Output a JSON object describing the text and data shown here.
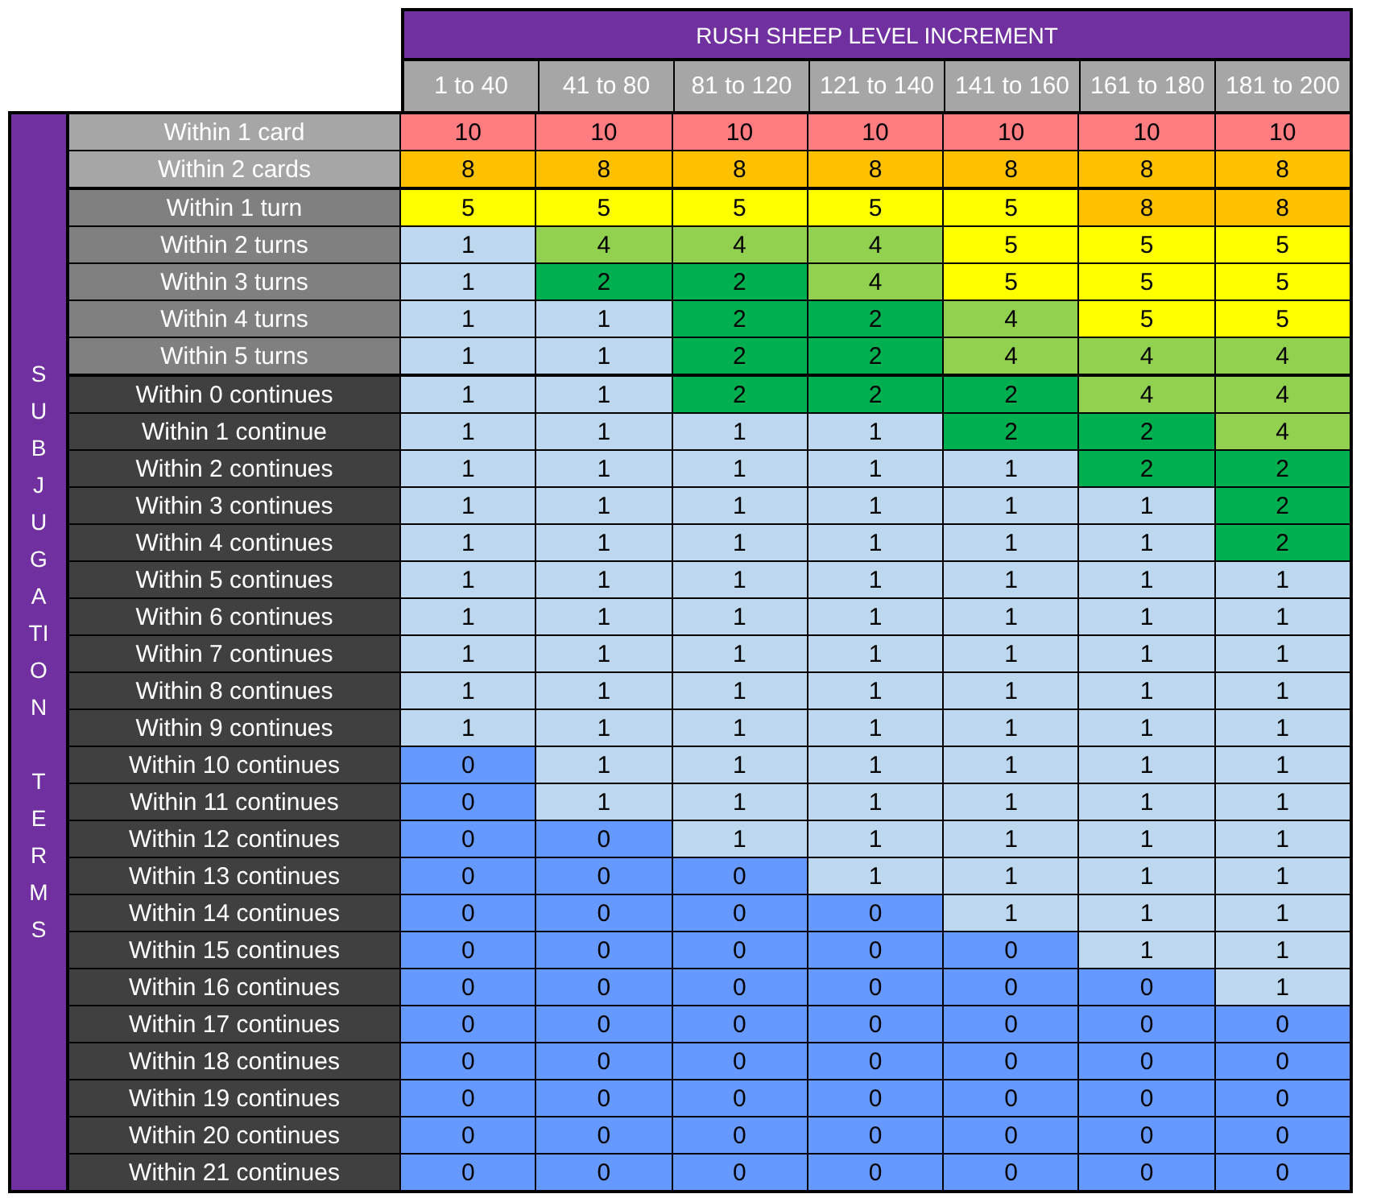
{
  "title": "RUSH SHEEP LEVEL INCREMENT",
  "columns": [
    "1 to 40",
    "41 to 80",
    "81 to 120",
    "121 to 140",
    "141 to 160",
    "161 to 180",
    "181 to 200"
  ],
  "side_label": "SUBJUGATION TERMS",
  "row_groups": [
    {
      "kind": "cards",
      "rows": [
        {
          "label": "Within 1 card",
          "cells": [
            {
              "text": "10",
              "color": "#ff7c80"
            },
            {
              "text": "10",
              "color": "#ff7c80"
            },
            {
              "text": "10",
              "color": "#ff7c80"
            },
            {
              "text": "10",
              "color": "#ff7c80"
            },
            {
              "text": "10",
              "color": "#ff7c80"
            },
            {
              "text": "10",
              "color": "#ff7c80"
            },
            {
              "text": "10",
              "color": "#ff7c80"
            }
          ]
        },
        {
          "label": "Within 2 cards",
          "cells": [
            {
              "text": "8",
              "color": "#ffc000"
            },
            {
              "text": "8",
              "color": "#ffc000"
            },
            {
              "text": "8",
              "color": "#ffc000"
            },
            {
              "text": "8",
              "color": "#ffc000"
            },
            {
              "text": "8",
              "color": "#ffc000"
            },
            {
              "text": "8",
              "color": "#ffc000"
            },
            {
              "text": "8",
              "color": "#ffc000"
            }
          ]
        }
      ]
    },
    {
      "kind": "turns",
      "rows": [
        {
          "label": "Within 1 turn",
          "cells": [
            {
              "text": "5",
              "color": "#ffff00"
            },
            {
              "text": "5",
              "color": "#ffff00"
            },
            {
              "text": "5",
              "color": "#ffff00"
            },
            {
              "text": "5",
              "color": "#ffff00"
            },
            {
              "text": "5",
              "color": "#ffff00"
            },
            {
              "text": "8",
              "color": "#ffc000"
            },
            {
              "text": "8",
              "color": "#ffc000"
            }
          ]
        },
        {
          "label": "Within 2 turns",
          "cells": [
            {
              "text": "1",
              "color": "#bdd7ee"
            },
            {
              "text": "4",
              "color": "#92d050"
            },
            {
              "text": "4",
              "color": "#92d050"
            },
            {
              "text": "4",
              "color": "#92d050"
            },
            {
              "text": "5",
              "color": "#ffff00"
            },
            {
              "text": "5",
              "color": "#ffff00"
            },
            {
              "text": "5",
              "color": "#ffff00"
            }
          ]
        },
        {
          "label": "Within 3 turns",
          "cells": [
            {
              "text": "1",
              "color": "#bdd7ee"
            },
            {
              "text": "2",
              "color": "#00b050"
            },
            {
              "text": "2",
              "color": "#00b050"
            },
            {
              "text": "4",
              "color": "#92d050"
            },
            {
              "text": "5",
              "color": "#ffff00"
            },
            {
              "text": "5",
              "color": "#ffff00"
            },
            {
              "text": "5",
              "color": "#ffff00"
            }
          ]
        },
        {
          "label": "Within 4 turns",
          "cells": [
            {
              "text": "1",
              "color": "#bdd7ee"
            },
            {
              "text": "1",
              "color": "#bdd7ee"
            },
            {
              "text": "2",
              "color": "#00b050"
            },
            {
              "text": "2",
              "color": "#00b050"
            },
            {
              "text": "4",
              "color": "#92d050"
            },
            {
              "text": "5",
              "color": "#ffff00"
            },
            {
              "text": "5",
              "color": "#ffff00"
            }
          ]
        },
        {
          "label": "Within 5 turns",
          "cells": [
            {
              "text": "1",
              "color": "#bdd7ee"
            },
            {
              "text": "1",
              "color": "#bdd7ee"
            },
            {
              "text": "2",
              "color": "#00b050"
            },
            {
              "text": "2",
              "color": "#00b050"
            },
            {
              "text": "4",
              "color": "#92d050"
            },
            {
              "text": "4",
              "color": "#92d050"
            },
            {
              "text": "4",
              "color": "#92d050"
            }
          ]
        }
      ]
    },
    {
      "kind": "continues",
      "rows": [
        {
          "label": "Within 0 continues",
          "cells": [
            {
              "text": "1",
              "color": "#bdd7ee"
            },
            {
              "text": "1",
              "color": "#bdd7ee"
            },
            {
              "text": "2",
              "color": "#00b050"
            },
            {
              "text": "2",
              "color": "#00b050"
            },
            {
              "text": "2",
              "color": "#00b050"
            },
            {
              "text": "4",
              "color": "#92d050"
            },
            {
              "text": "4",
              "color": "#92d050"
            }
          ]
        },
        {
          "label": "Within 1 continue",
          "cells": [
            {
              "text": "1",
              "color": "#bdd7ee"
            },
            {
              "text": "1",
              "color": "#bdd7ee"
            },
            {
              "text": "1",
              "color": "#bdd7ee"
            },
            {
              "text": "1",
              "color": "#bdd7ee"
            },
            {
              "text": "2",
              "color": "#00b050"
            },
            {
              "text": "2",
              "color": "#00b050"
            },
            {
              "text": "4",
              "color": "#92d050"
            }
          ]
        },
        {
          "label": "Within 2 continues",
          "cells": [
            {
              "text": "1",
              "color": "#bdd7ee"
            },
            {
              "text": "1",
              "color": "#bdd7ee"
            },
            {
              "text": "1",
              "color": "#bdd7ee"
            },
            {
              "text": "1",
              "color": "#bdd7ee"
            },
            {
              "text": "1",
              "color": "#bdd7ee"
            },
            {
              "text": "2",
              "color": "#00b050"
            },
            {
              "text": "2",
              "color": "#00b050"
            }
          ]
        },
        {
          "label": "Within 3 continues",
          "cells": [
            {
              "text": "1",
              "color": "#bdd7ee"
            },
            {
              "text": "1",
              "color": "#bdd7ee"
            },
            {
              "text": "1",
              "color": "#bdd7ee"
            },
            {
              "text": "1",
              "color": "#bdd7ee"
            },
            {
              "text": "1",
              "color": "#bdd7ee"
            },
            {
              "text": "1",
              "color": "#bdd7ee"
            },
            {
              "text": "2",
              "color": "#00b050"
            }
          ]
        },
        {
          "label": "Within 4 continues",
          "cells": [
            {
              "text": "1",
              "color": "#bdd7ee"
            },
            {
              "text": "1",
              "color": "#bdd7ee"
            },
            {
              "text": "1",
              "color": "#bdd7ee"
            },
            {
              "text": "1",
              "color": "#bdd7ee"
            },
            {
              "text": "1",
              "color": "#bdd7ee"
            },
            {
              "text": "1",
              "color": "#bdd7ee"
            },
            {
              "text": "2",
              "color": "#00b050"
            }
          ]
        },
        {
          "label": "Within 5 continues",
          "cells": [
            {
              "text": "1",
              "color": "#bdd7ee"
            },
            {
              "text": "1",
              "color": "#bdd7ee"
            },
            {
              "text": "1",
              "color": "#bdd7ee"
            },
            {
              "text": "1",
              "color": "#bdd7ee"
            },
            {
              "text": "1",
              "color": "#bdd7ee"
            },
            {
              "text": "1",
              "color": "#bdd7ee"
            },
            {
              "text": "1",
              "color": "#bdd7ee"
            }
          ]
        },
        {
          "label": "Within 6 continues",
          "cells": [
            {
              "text": "1",
              "color": "#bdd7ee"
            },
            {
              "text": "1",
              "color": "#bdd7ee"
            },
            {
              "text": "1",
              "color": "#bdd7ee"
            },
            {
              "text": "1",
              "color": "#bdd7ee"
            },
            {
              "text": "1",
              "color": "#bdd7ee"
            },
            {
              "text": "1",
              "color": "#bdd7ee"
            },
            {
              "text": "1",
              "color": "#bdd7ee"
            }
          ]
        },
        {
          "label": "Within 7 continues",
          "cells": [
            {
              "text": "1",
              "color": "#bdd7ee"
            },
            {
              "text": "1",
              "color": "#bdd7ee"
            },
            {
              "text": "1",
              "color": "#bdd7ee"
            },
            {
              "text": "1",
              "color": "#bdd7ee"
            },
            {
              "text": "1",
              "color": "#bdd7ee"
            },
            {
              "text": "1",
              "color": "#bdd7ee"
            },
            {
              "text": "1",
              "color": "#bdd7ee"
            }
          ]
        },
        {
          "label": "Within 8 continues",
          "cells": [
            {
              "text": "1",
              "color": "#bdd7ee"
            },
            {
              "text": "1",
              "color": "#bdd7ee"
            },
            {
              "text": "1",
              "color": "#bdd7ee"
            },
            {
              "text": "1",
              "color": "#bdd7ee"
            },
            {
              "text": "1",
              "color": "#bdd7ee"
            },
            {
              "text": "1",
              "color": "#bdd7ee"
            },
            {
              "text": "1",
              "color": "#bdd7ee"
            }
          ]
        },
        {
          "label": "Within 9 continues",
          "cells": [
            {
              "text": "1",
              "color": "#bdd7ee"
            },
            {
              "text": "1",
              "color": "#bdd7ee"
            },
            {
              "text": "1",
              "color": "#bdd7ee"
            },
            {
              "text": "1",
              "color": "#bdd7ee"
            },
            {
              "text": "1",
              "color": "#bdd7ee"
            },
            {
              "text": "1",
              "color": "#bdd7ee"
            },
            {
              "text": "1",
              "color": "#bdd7ee"
            }
          ]
        },
        {
          "label": "Within 10 continues",
          "cells": [
            {
              "text": "0",
              "color": "#6699ff"
            },
            {
              "text": "1",
              "color": "#bdd7ee"
            },
            {
              "text": "1",
              "color": "#bdd7ee"
            },
            {
              "text": "1",
              "color": "#bdd7ee"
            },
            {
              "text": "1",
              "color": "#bdd7ee"
            },
            {
              "text": "1",
              "color": "#bdd7ee"
            },
            {
              "text": "1",
              "color": "#bdd7ee"
            }
          ]
        },
        {
          "label": "Within 11 continues",
          "cells": [
            {
              "text": "0",
              "color": "#6699ff"
            },
            {
              "text": "1",
              "color": "#bdd7ee"
            },
            {
              "text": "1",
              "color": "#bdd7ee"
            },
            {
              "text": "1",
              "color": "#bdd7ee"
            },
            {
              "text": "1",
              "color": "#bdd7ee"
            },
            {
              "text": "1",
              "color": "#bdd7ee"
            },
            {
              "text": "1",
              "color": "#bdd7ee"
            }
          ]
        },
        {
          "label": "Within 12 continues",
          "cells": [
            {
              "text": "0",
              "color": "#6699ff"
            },
            {
              "text": "0",
              "color": "#6699ff"
            },
            {
              "text": "1",
              "color": "#bdd7ee"
            },
            {
              "text": "1",
              "color": "#bdd7ee"
            },
            {
              "text": "1",
              "color": "#bdd7ee"
            },
            {
              "text": "1",
              "color": "#bdd7ee"
            },
            {
              "text": "1",
              "color": "#bdd7ee"
            }
          ]
        },
        {
          "label": "Within 13 continues",
          "cells": [
            {
              "text": "0",
              "color": "#6699ff"
            },
            {
              "text": "0",
              "color": "#6699ff"
            },
            {
              "text": "0",
              "color": "#6699ff"
            },
            {
              "text": "1",
              "color": "#bdd7ee"
            },
            {
              "text": "1",
              "color": "#bdd7ee"
            },
            {
              "text": "1",
              "color": "#bdd7ee"
            },
            {
              "text": "1",
              "color": "#bdd7ee"
            }
          ]
        },
        {
          "label": "Within 14 continues",
          "cells": [
            {
              "text": "0",
              "color": "#6699ff"
            },
            {
              "text": "0",
              "color": "#6699ff"
            },
            {
              "text": "0",
              "color": "#6699ff"
            },
            {
              "text": "0",
              "color": "#6699ff"
            },
            {
              "text": "1",
              "color": "#bdd7ee"
            },
            {
              "text": "1",
              "color": "#bdd7ee"
            },
            {
              "text": "1",
              "color": "#bdd7ee"
            }
          ]
        },
        {
          "label": "Within 15 continues",
          "cells": [
            {
              "text": "0",
              "color": "#6699ff"
            },
            {
              "text": "0",
              "color": "#6699ff"
            },
            {
              "text": "0",
              "color": "#6699ff"
            },
            {
              "text": "0",
              "color": "#6699ff"
            },
            {
              "text": "0",
              "color": "#6699ff"
            },
            {
              "text": "1",
              "color": "#bdd7ee"
            },
            {
              "text": "1",
              "color": "#bdd7ee"
            }
          ]
        },
        {
          "label": "Within 16 continues",
          "cells": [
            {
              "text": "0",
              "color": "#6699ff"
            },
            {
              "text": "0",
              "color": "#6699ff"
            },
            {
              "text": "0",
              "color": "#6699ff"
            },
            {
              "text": "0",
              "color": "#6699ff"
            },
            {
              "text": "0",
              "color": "#6699ff"
            },
            {
              "text": "0",
              "color": "#6699ff"
            },
            {
              "text": "1",
              "color": "#bdd7ee"
            }
          ]
        },
        {
          "label": "Within 17 continues",
          "cells": [
            {
              "text": "0",
              "color": "#6699ff"
            },
            {
              "text": "0",
              "color": "#6699ff"
            },
            {
              "text": "0",
              "color": "#6699ff"
            },
            {
              "text": "0",
              "color": "#6699ff"
            },
            {
              "text": "0",
              "color": "#6699ff"
            },
            {
              "text": "0",
              "color": "#6699ff"
            },
            {
              "text": "0",
              "color": "#6699ff"
            }
          ]
        },
        {
          "label": "Within 18 continues",
          "cells": [
            {
              "text": "0",
              "color": "#6699ff"
            },
            {
              "text": "0",
              "color": "#6699ff"
            },
            {
              "text": "0",
              "color": "#6699ff"
            },
            {
              "text": "0",
              "color": "#6699ff"
            },
            {
              "text": "0",
              "color": "#6699ff"
            },
            {
              "text": "0",
              "color": "#6699ff"
            },
            {
              "text": "0",
              "color": "#6699ff"
            }
          ]
        },
        {
          "label": "Within 19 continues",
          "cells": [
            {
              "text": "0",
              "color": "#6699ff"
            },
            {
              "text": "0",
              "color": "#6699ff"
            },
            {
              "text": "0",
              "color": "#6699ff"
            },
            {
              "text": "0",
              "color": "#6699ff"
            },
            {
              "text": "0",
              "color": "#6699ff"
            },
            {
              "text": "0",
              "color": "#6699ff"
            },
            {
              "text": "0",
              "color": "#6699ff"
            }
          ]
        },
        {
          "label": "Within 20 continues",
          "cells": [
            {
              "text": "0",
              "color": "#6699ff"
            },
            {
              "text": "0",
              "color": "#6699ff"
            },
            {
              "text": "0",
              "color": "#6699ff"
            },
            {
              "text": "0",
              "color": "#6699ff"
            },
            {
              "text": "0",
              "color": "#6699ff"
            },
            {
              "text": "0",
              "color": "#6699ff"
            },
            {
              "text": "0",
              "color": "#6699ff"
            }
          ]
        },
        {
          "label": "Within 21 continues",
          "cells": [
            {
              "text": "0",
              "color": "#6699ff"
            },
            {
              "text": "0",
              "color": "#6699ff"
            },
            {
              "text": "0",
              "color": "#6699ff"
            },
            {
              "text": "0",
              "color": "#6699ff"
            },
            {
              "text": "0",
              "color": "#6699ff"
            },
            {
              "text": "0",
              "color": "#6699ff"
            },
            {
              "text": "0",
              "color": "#6699ff"
            }
          ]
        }
      ]
    }
  ]
}
